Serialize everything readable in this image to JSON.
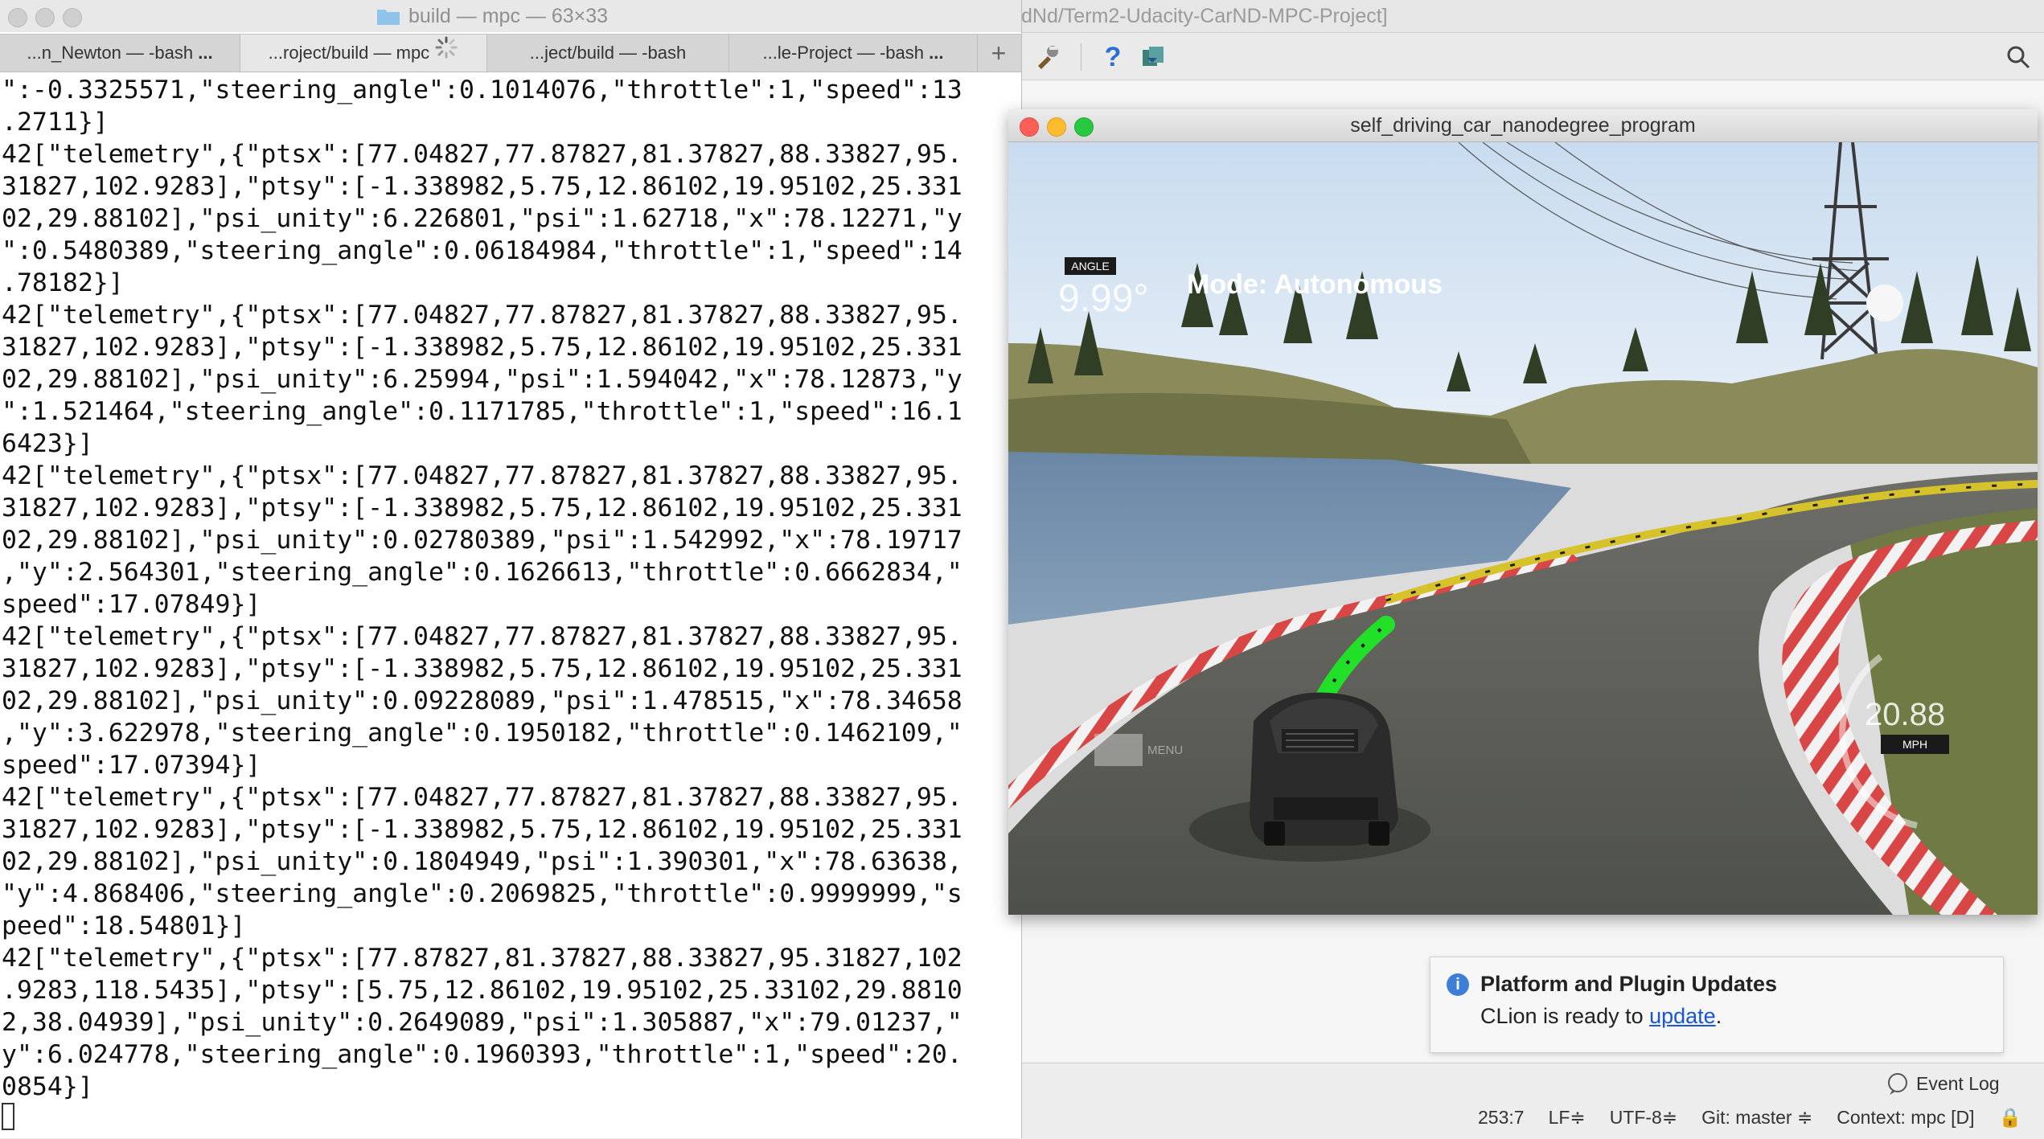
{
  "terminal": {
    "title": "build — mpc — 63×33",
    "tabs": [
      {
        "label": "...n_Newton — -bash",
        "ellipsis": "..."
      },
      {
        "label": "...roject/build — mpc"
      },
      {
        "label": "...ject/build — -bash"
      },
      {
        "label": "...le-Project — -bash",
        "ellipsis": "..."
      }
    ],
    "new_tab": "+",
    "lines": [
      "\":-0.3325571,\"steering_angle\":0.1014076,\"throttle\":1,\"speed\":13",
      ".2711}]",
      "42[\"telemetry\",{\"ptsx\":[77.04827,77.87827,81.37827,88.33827,95.",
      "31827,102.9283],\"ptsy\":[-1.338982,5.75,12.86102,19.95102,25.331",
      "02,29.88102],\"psi_unity\":6.226801,\"psi\":1.62718,\"x\":78.12271,\"y",
      "\":0.5480389,\"steering_angle\":0.06184984,\"throttle\":1,\"speed\":14",
      ".78182}]",
      "42[\"telemetry\",{\"ptsx\":[77.04827,77.87827,81.37827,88.33827,95.",
      "31827,102.9283],\"ptsy\":[-1.338982,5.75,12.86102,19.95102,25.331",
      "02,29.88102],\"psi_unity\":6.25994,\"psi\":1.594042,\"x\":78.12873,\"y",
      "\":1.521464,\"steering_angle\":0.1171785,\"throttle\":1,\"speed\":16.1",
      "6423}]",
      "42[\"telemetry\",{\"ptsx\":[77.04827,77.87827,81.37827,88.33827,95.",
      "31827,102.9283],\"ptsy\":[-1.338982,5.75,12.86102,19.95102,25.331",
      "02,29.88102],\"psi_unity\":0.02780389,\"psi\":1.542992,\"x\":78.19717",
      ",\"y\":2.564301,\"steering_angle\":0.1626613,\"throttle\":0.6662834,\"",
      "speed\":17.07849}]",
      "42[\"telemetry\",{\"ptsx\":[77.04827,77.87827,81.37827,88.33827,95.",
      "31827,102.9283],\"ptsy\":[-1.338982,5.75,12.86102,19.95102,25.331",
      "02,29.88102],\"psi_unity\":0.09228089,\"psi\":1.478515,\"x\":78.34658",
      ",\"y\":3.622978,\"steering_angle\":0.1950182,\"throttle\":0.1462109,\"",
      "speed\":17.07394}]",
      "42[\"telemetry\",{\"ptsx\":[77.04827,77.87827,81.37827,88.33827,95.",
      "31827,102.9283],\"ptsy\":[-1.338982,5.75,12.86102,19.95102,25.331",
      "02,29.88102],\"psi_unity\":0.1804949,\"psi\":1.390301,\"x\":78.63638,",
      "\"y\":4.868406,\"steering_angle\":0.2069825,\"throttle\":0.9999999,\"s",
      "peed\":18.54801}]",
      "42[\"telemetry\",{\"ptsx\":[77.87827,81.37827,88.33827,95.31827,102",
      ".9283,118.5435],\"ptsy\":[5.75,12.86102,19.95102,25.33102,29.8810",
      "2,38.04939],\"psi_unity\":0.2649089,\"psi\":1.305887,\"x\":79.01237,\"",
      "y\":6.024778,\"steering_angle\":0.1960393,\"throttle\":1,\"speed\":20.",
      "0854}]"
    ]
  },
  "ide": {
    "title": "dNd/Term2-Udacity-CarND-MPC-Project]",
    "notification": {
      "title": "Platform and Plugin Updates",
      "body_prefix": "CLion is ready to ",
      "link": "update",
      "body_suffix": "."
    },
    "event_log": "Event Log",
    "status": {
      "position": "253:7",
      "line_sep": "LF≑",
      "encoding": "UTF-8≑",
      "git": "Git: master ≑",
      "context": "Context: mpc [D]"
    }
  },
  "simulator": {
    "title": "self_driving_car_nanodegree_program",
    "angle_label": "ANGLE",
    "angle_value": "9.99°",
    "mode": "Mode: Autonomous",
    "speed_value": "20.88",
    "speed_unit": "MPH",
    "menu_label": "MENU"
  }
}
